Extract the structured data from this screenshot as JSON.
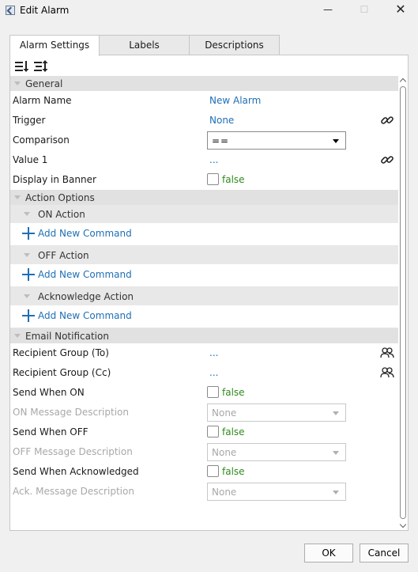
{
  "window": {
    "title": "Edit Alarm",
    "minimize": "—",
    "maximize": "☐",
    "close": "✕"
  },
  "tabs": [
    "Alarm Settings",
    "Labels",
    "Descriptions"
  ],
  "toolbar": {
    "sort_icon": "sort-categorized-icon",
    "sort_alpha_icon": "sort-alphabetical-icon"
  },
  "categories": {
    "general": "General",
    "action_options": "Action Options",
    "on_action": "ON Action",
    "off_action": "OFF Action",
    "ack_action": "Acknowledge Action",
    "email": "Email Notification"
  },
  "general": {
    "alarm_name_label": "Alarm Name",
    "alarm_name_value": "New Alarm",
    "trigger_label": "Trigger",
    "trigger_value": "None",
    "comparison_label": "Comparison",
    "comparison_value": "==",
    "value1_label": "Value 1",
    "value1_value": "...",
    "banner_label": "Display in Banner",
    "banner_value": "false"
  },
  "actions": {
    "add_command": "Add New Command"
  },
  "email": {
    "to_label": "Recipient Group (To)",
    "to_value": "...",
    "cc_label": "Recipient Group (Cc)",
    "cc_value": "...",
    "send_on_label": "Send When ON",
    "send_on_value": "false",
    "on_msg_label": "ON Message Description",
    "on_msg_value": "None",
    "send_off_label": "Send When OFF",
    "send_off_value": "false",
    "off_msg_label": "OFF Message Description",
    "off_msg_value": "None",
    "send_ack_label": "Send When Acknowledged",
    "send_ack_value": "false",
    "ack_msg_label": "Ack. Message Description",
    "ack_msg_value": "None"
  },
  "buttons": {
    "ok": "OK",
    "cancel": "Cancel"
  },
  "colors": {
    "link": "#1f6fb5",
    "false_value": "#2e8b1a",
    "category_bg": "#e1e1e1"
  }
}
